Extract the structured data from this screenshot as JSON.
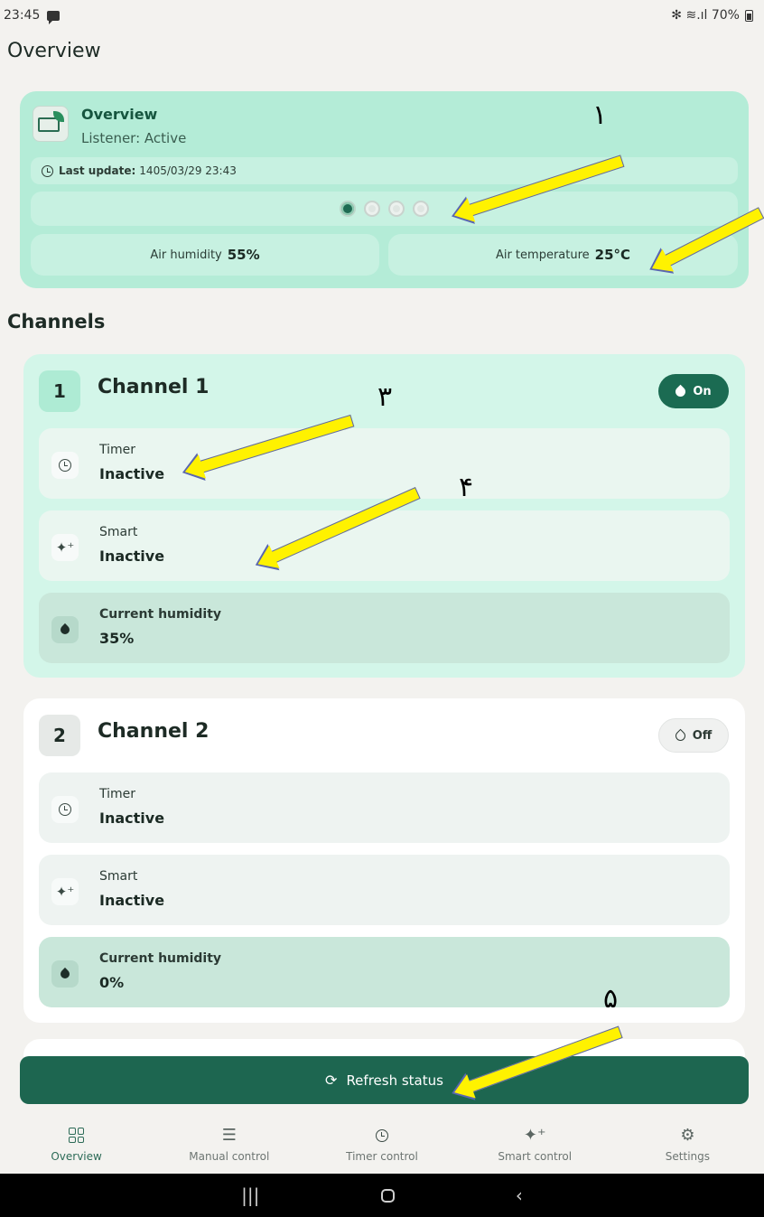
{
  "status_bar": {
    "time": "23:45",
    "indicators": "✻ ≋.ıl 70%"
  },
  "page": {
    "title": "Overview"
  },
  "overview": {
    "title": "Overview",
    "listener": "Listener: Active",
    "last_update_label": "Last update:",
    "last_update_value": "1405/03/29 23:43",
    "pager_total": 4,
    "pager_active": 1,
    "humidity_label": "Air humidity",
    "humidity_value": "55%",
    "temperature_label": "Air temperature",
    "temperature_value": "25°C"
  },
  "channels_title": "Channels",
  "channels": [
    {
      "number": "1",
      "name": "Channel 1",
      "status": "On",
      "timer_label": "Timer",
      "timer_value": "Inactive",
      "smart_label": "Smart",
      "smart_value": "Inactive",
      "humidity_label": "Current humidity",
      "humidity_value": "35%"
    },
    {
      "number": "2",
      "name": "Channel 2",
      "status": "Off",
      "timer_label": "Timer",
      "timer_value": "Inactive",
      "smart_label": "Smart",
      "smart_value": "Inactive",
      "humidity_label": "Current humidity",
      "humidity_value": "0%"
    }
  ],
  "refresh_label": "Refresh status",
  "nav": [
    {
      "label": "Overview",
      "icon": "grid-icon"
    },
    {
      "label": "Manual control",
      "icon": "sliders-icon"
    },
    {
      "label": "Timer control",
      "icon": "clock-icon"
    },
    {
      "label": "Smart control",
      "icon": "sparkle-icon"
    },
    {
      "label": "Settings",
      "icon": "gear-icon"
    }
  ],
  "annotations": [
    "١",
    "٣",
    "۴",
    "۵"
  ],
  "colors": {
    "accent": "#1d6650",
    "card_mint": "#b4ecd7",
    "channel_on_bg": "#d3f6e9",
    "annotation_arrow": "#fff200"
  }
}
